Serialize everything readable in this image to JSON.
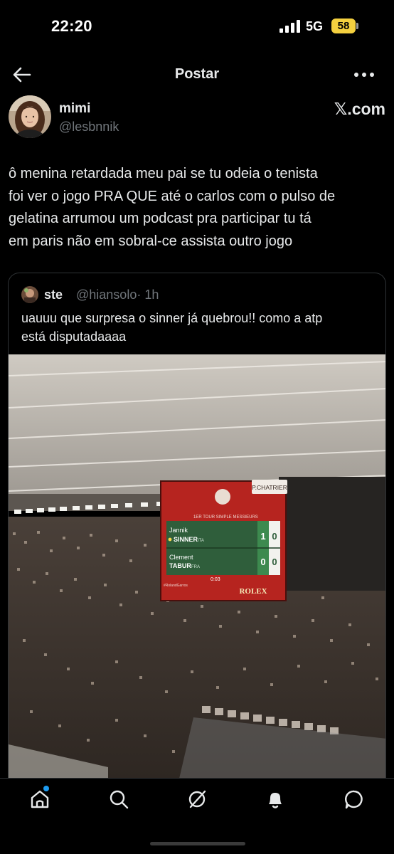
{
  "status_bar": {
    "time": "22:20",
    "network": "5G",
    "battery": "58",
    "battery_color": "#f4d03f"
  },
  "header": {
    "title": "Postar",
    "back_icon": "arrow-left-icon",
    "more_icon": "more-horizontal-icon"
  },
  "post": {
    "author": {
      "name": "mimi",
      "handle": "@lesbnnik",
      "watermark": "𝕏.com"
    },
    "text": "ô menina retardada meu pai se tu odeia o tenista\nfoi ver o jogo PRA QUE até o carlos com o pulso de\ngelatina arrumou um podcast pra participar tu tá\nem paris não em sobral-ce assista outro jogo"
  },
  "quoted_post": {
    "name": "ste",
    "handle": "@hiansolo",
    "time": "· 1h",
    "text": "uauuu que surpresa o sinner já quebrou!! como a atp\nestá disputadaaaa",
    "photo": {
      "court_sign": "P.CHATRIER",
      "event": "1ER TOUR SIMPLE MESSIEURS",
      "player1_first": "Jannik",
      "player1_last": "SINNER",
      "player1_country": "ITA",
      "player1_sets": "1",
      "player1_games": "0",
      "player2_first": "Clement",
      "player2_last": "TABUR",
      "player2_country": "FRA",
      "player2_sets": "0",
      "player2_games": "0",
      "clock": "0:03",
      "sponsor": "ROLEX",
      "hashtag": "#RolandGarros"
    }
  },
  "tab_bar": {
    "items": [
      "home-icon",
      "search-icon",
      "grok-icon",
      "notifications-icon",
      "messages-icon"
    ],
    "accent": "#1d9bf0"
  }
}
